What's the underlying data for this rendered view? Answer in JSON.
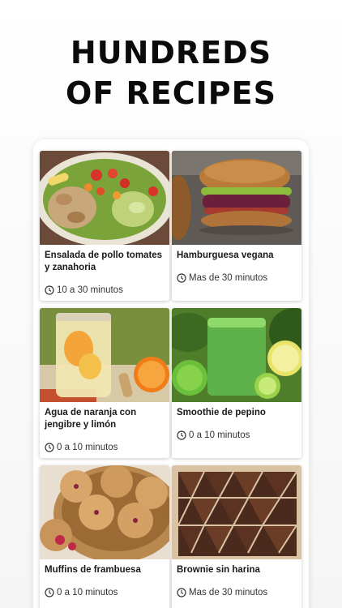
{
  "headline": {
    "line1": "HUNDREDS",
    "line2": "OF RECIPES"
  },
  "recipes": [
    {
      "title": "Ensalada de pollo tomates y zanahoria",
      "time": "10 a 30 minutos",
      "image": "chicken-salad"
    },
    {
      "title": "Hamburguesa vegana",
      "time": "Mas de 30 minutos",
      "image": "vegan-burger"
    },
    {
      "title": "Agua de naranja con jengibre y limón",
      "time": "0 a 10 minutos",
      "image": "orange-water"
    },
    {
      "title": "Smoothie de pepino",
      "time": "0 a 10 minutos",
      "image": "green-smoothie"
    },
    {
      "title": "Muffins de frambuesa",
      "time": "0 a 10 minutos",
      "image": "raspberry-muffins"
    },
    {
      "title": "Brownie sin harina",
      "time": "Mas de 30 minutos",
      "image": "brownie"
    }
  ],
  "icons": {
    "time": "clock-icon"
  },
  "colors": {
    "background": "#f7f7f7",
    "headline": "#0b0b0b",
    "card": "#ffffff"
  }
}
